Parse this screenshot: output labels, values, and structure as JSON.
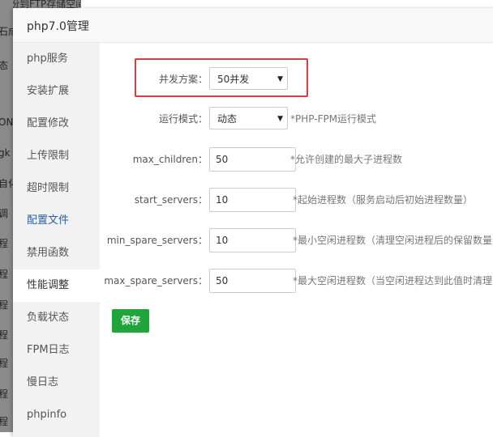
{
  "background": {
    "top_text": "行份到FTP存储空间.",
    "fragments": [
      "石成",
      "态",
      "ON",
      "gk",
      "自化",
      "调",
      "程",
      "程",
      "程",
      "程",
      "程",
      "程",
      "程"
    ]
  },
  "dialog": {
    "title": "php7.0管理"
  },
  "sidebar": {
    "items": [
      {
        "label": "php服务"
      },
      {
        "label": "安装扩展"
      },
      {
        "label": "配置修改"
      },
      {
        "label": "上传限制"
      },
      {
        "label": "超时限制"
      },
      {
        "label": "配置文件"
      },
      {
        "label": "禁用函数"
      },
      {
        "label": "性能调整"
      },
      {
        "label": "负载状态"
      },
      {
        "label": "FPM日志"
      },
      {
        "label": "慢日志"
      },
      {
        "label": "phpinfo"
      }
    ],
    "active_item": "性能调整",
    "highlight_item": "配置文件"
  },
  "form": {
    "concurrency": {
      "label": "并发方案：",
      "value": "50并发"
    },
    "run_mode": {
      "label": "运行模式：",
      "value": "动态",
      "hint": "*PHP-FPM运行模式"
    },
    "max_children": {
      "label": "max_children：",
      "value": "50",
      "hint": "*允许创建的最大子进程数"
    },
    "start_servers": {
      "label": "start_servers：",
      "value": "10",
      "hint": "*起始进程数（服务启动后初始进程数量）"
    },
    "min_spare_servers": {
      "label": "min_spare_servers：",
      "value": "10",
      "hint": "*最小空闲进程数（清理空闲进程后的保留数量"
    },
    "max_spare_servers": {
      "label": "max_spare_servers：",
      "value": "50",
      "hint": "*最大空闲进程数（当空闲进程达到此值时清理"
    },
    "save_label": "保存"
  },
  "colors": {
    "accent_green": "#20a53a",
    "highlight_red": "#e0393e",
    "active_menu_text": "#2f5fa0"
  }
}
